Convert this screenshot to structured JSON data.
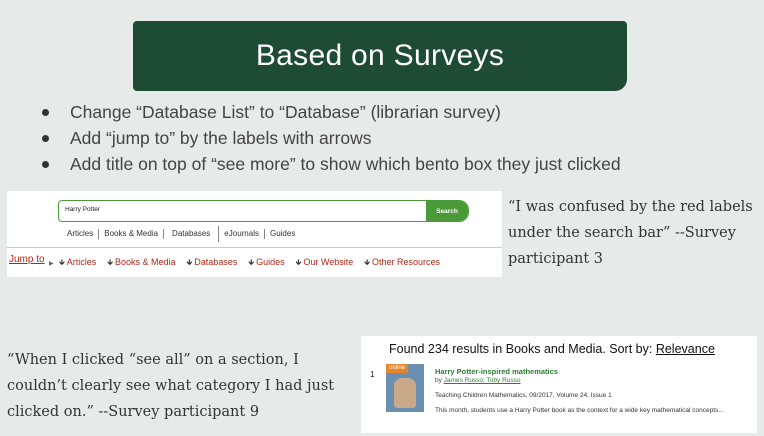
{
  "title": "Based on Surveys",
  "bullets": [
    "Change “Database List” to “Database” (librarian survey)",
    "Add “jump to” by the labels with arrows",
    "Add title on top of “see more” to show which bento box they just clicked"
  ],
  "search_screenshot": {
    "query": "Harry Potter",
    "search_button": "Search",
    "tabs": [
      "Articles",
      "Books & Media",
      "Databases",
      "eJournals",
      "Guides"
    ],
    "jump_label": "Jump to",
    "jump_links": [
      "Articles",
      "Books & Media",
      "Databases",
      "Guides",
      "Our Website",
      "Other Resources"
    ]
  },
  "quote_right": {
    "text": "“I was confused by the red labels under the search bar” --Survey participant 3"
  },
  "quote_left": {
    "text": "“When I clicked “see all” on a section, I couldn’t clearly see what category I had just clicked on.”  --Survey participant 9"
  },
  "results_screenshot": {
    "found_prefix": "Found 234 results in Books and Media. Sort by: ",
    "sort_value": "Relevance",
    "result_number": "1",
    "badge": "online",
    "result_title": "Harry Potter-inspired mathematics",
    "by_label": "by ",
    "authors": "James Russo; Toby Russo",
    "source": "Teaching Children Mathematics, 09/2017, Volume 24, Issue 1",
    "description": "This month, students use a Harry Potter book as the context for a wide key mathematical concepts..."
  }
}
